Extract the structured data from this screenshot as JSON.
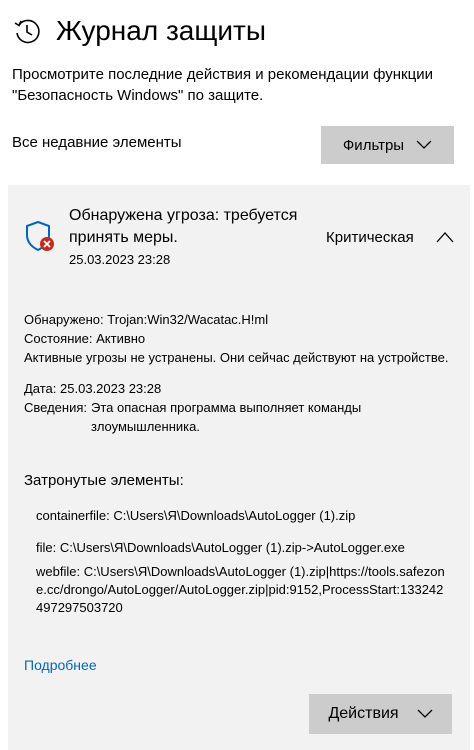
{
  "header": {
    "title": "Журнал защиты",
    "icon": "history-icon"
  },
  "description": "Просмотрите последние действия и рекомендации функции \"Безопасность Windows\" по защите.",
  "recent_label": "Все недавние элементы",
  "filters_button": {
    "label": "Фильтры",
    "icon": "chevron-down-icon"
  },
  "threat": {
    "title": "Обнаружена угроза: требуется принять меры.",
    "date": "25.03.2023 23:28",
    "severity": "Критическая",
    "severity_color": "#c42b1c",
    "shield_color": "#0067c0",
    "details": {
      "detected_label": "Обнаружено:",
      "detected_value": "Trojan:Win32/Wacatac.H!ml",
      "status_label": "Состояние:",
      "status_value": "Активно",
      "status_note": "Активные угрозы не устранены. Они сейчас действуют на устройстве.",
      "date_label": "Дата:",
      "date_value": "25.03.2023 23:28",
      "info_label": "Сведения:",
      "info_value": "Эта опасная программа выполняет команды злоумышленника."
    },
    "affected_heading": "Затронутые элементы:",
    "affected_items": [
      "containerfile: C:\\Users\\Я\\Downloads\\AutoLogger (1).zip",
      "file: C:\\Users\\Я\\Downloads\\AutoLogger (1).zip->AutoLogger.exe",
      "webfile: C:\\Users\\Я\\Downloads\\AutoLogger (1).zip|https://tools.safezone.cc/drongo/AutoLogger/AutoLogger.zip|pid:9152,ProcessStart:133242497297503720"
    ],
    "more_link": "Подробнее",
    "actions_button": "Действия"
  }
}
